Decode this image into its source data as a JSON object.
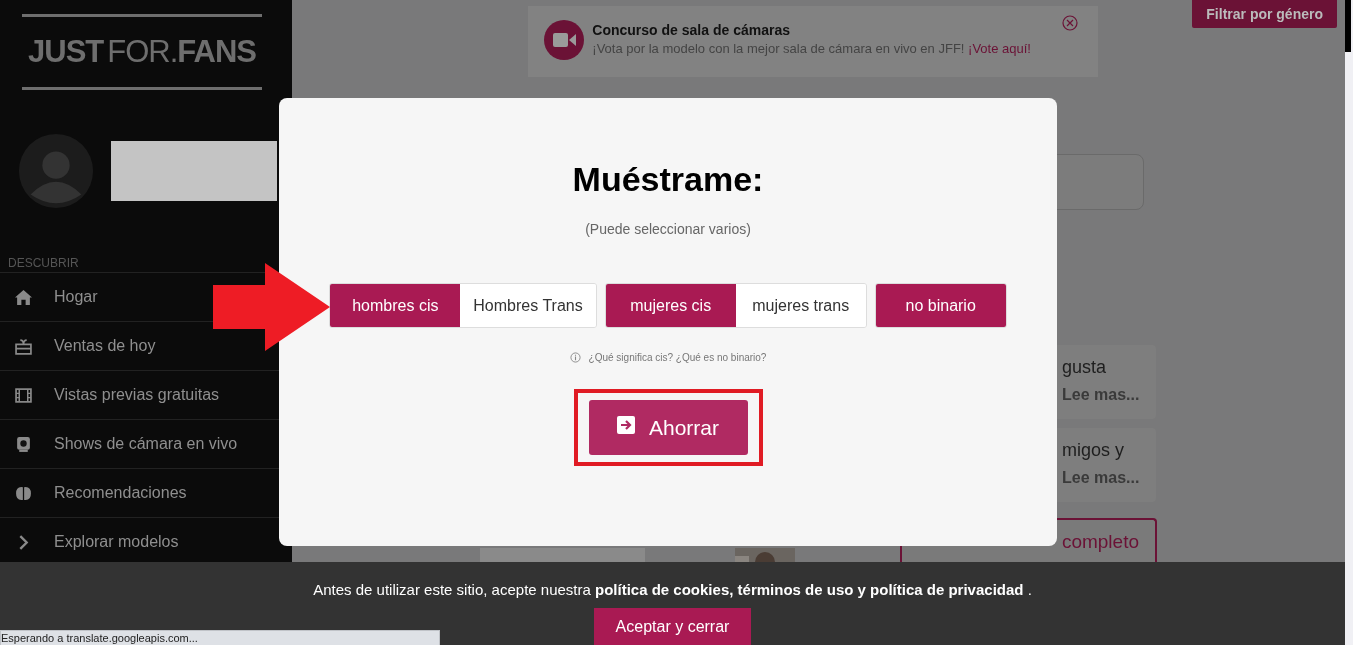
{
  "logo": {
    "part_1": "JUST",
    "part_2": "FOR.",
    "part_3": "FANS"
  },
  "sidebar": {
    "section": "DESCUBRIR",
    "items": [
      {
        "label": "Hogar",
        "kind": "home"
      },
      {
        "label": "Ventas de hoy",
        "kind": "gift"
      },
      {
        "label": "Vistas previas gratuitas",
        "kind": "film"
      },
      {
        "label": "Shows de cámara en vivo",
        "kind": "webcam"
      },
      {
        "label": "Recomendaciones",
        "kind": "brain"
      },
      {
        "label": "Explorar modelos",
        "kind": "chevron"
      }
    ]
  },
  "banner": {
    "title": "Concurso de sala de cámaras",
    "text": "¡Vota por la modelo con la mejor sala de cámara en vivo en JFF!",
    "link": "¡Vote aquí!"
  },
  "filter_button": "Filtrar por género",
  "cards": [
    {
      "text": "gusta",
      "link": "Lee mas..."
    },
    {
      "text": "migos y",
      "link": "Lee mas..."
    }
  ],
  "spotlight_button": "completo",
  "modal": {
    "title": "Muéstrame:",
    "hint": "(Puede seleccionar varios)",
    "groups": [
      [
        {
          "label": "hombres cis",
          "selected": true
        },
        {
          "label": "Hombres Trans",
          "selected": false
        }
      ],
      [
        {
          "label": "mujeres cis",
          "selected": true
        },
        {
          "label": "mujeres trans",
          "selected": false
        }
      ],
      [
        {
          "label": "no binario",
          "selected": true
        }
      ]
    ],
    "help": "¿Qué significa cis? ¿Qué es no binario?",
    "save": "Ahorrar"
  },
  "cookie": {
    "text": "Antes de utilizar este sitio, acepte nuestra **política de cookies, términos de uso y política de privacidad** .",
    "button": "Aceptar y cerrar"
  },
  "status": "Esperando a translate.googleapis.com..."
}
